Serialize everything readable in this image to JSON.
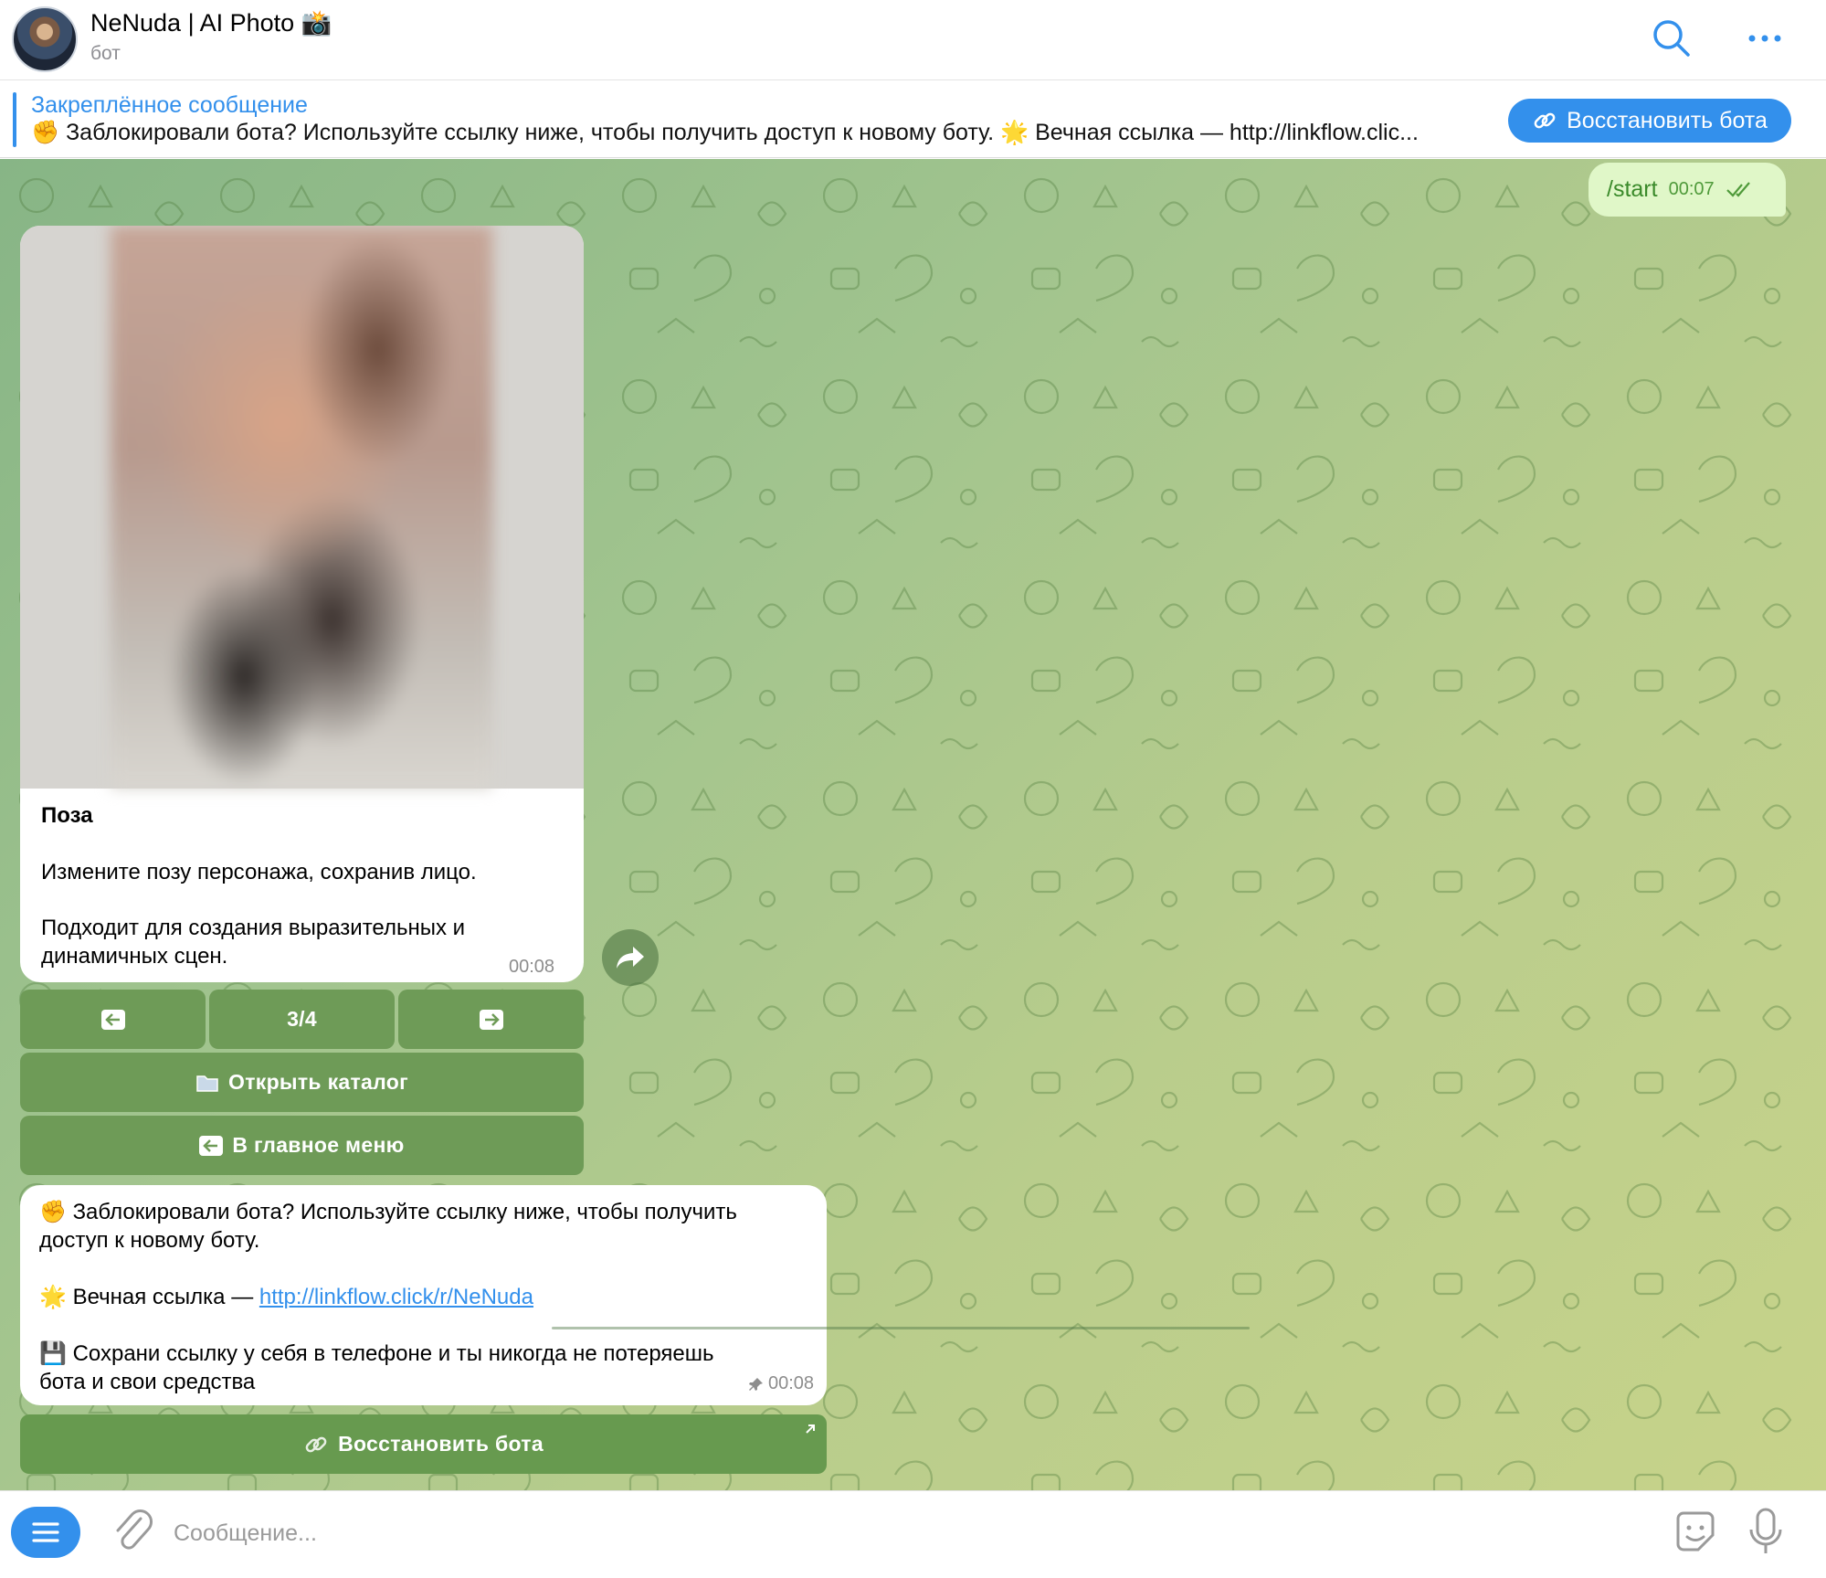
{
  "header": {
    "title": "NeNuda | AI Photo 📸",
    "subtitle": "бот"
  },
  "pinned": {
    "label": "Закреплённое сообщение",
    "text": "✊ Заблокировали бота? Используйте ссылку ниже, чтобы получить доступ к новому боту.  🌟 Вечная ссылка — http://linkflow.clic...",
    "button": "Восстановить бота"
  },
  "outgoing": {
    "text": "/start",
    "time": "00:07"
  },
  "card": {
    "title": "Поза",
    "line1": "Измените позу персонажа, сохранив лицо.",
    "line2": "Подходит для создания выразительных и",
    "line3": "динамичных сцен.",
    "time": "00:08"
  },
  "keyboard": {
    "prev_icon": "left-arrow-icon",
    "counter": "3/4",
    "next_icon": "right-arrow-icon",
    "catalog": "Открыть каталог",
    "main_menu": "В главное меню"
  },
  "info": {
    "line1_emoji": "✊",
    "line1": "Заблокировали бота? Используйте ссылку ниже, чтобы получить",
    "line2": "доступ к новому боту.",
    "line3_emoji": "🌟",
    "line3_prefix": "Вечная ссылка — ",
    "link": "http://linkflow.click/r/NeNuda",
    "line4_emoji": "💾",
    "line4": "Сохрани ссылку у себя в телефоне и ты никогда не потеряешь",
    "line5": "бота и свои средства",
    "time": "00:08",
    "button": "Восстановить бота"
  },
  "composer": {
    "placeholder": "Сообщение..."
  },
  "colors": {
    "accent": "#3390ec",
    "keyboard_button": "#6e9b57",
    "outgoing_bubble": "#e0f7c8"
  }
}
